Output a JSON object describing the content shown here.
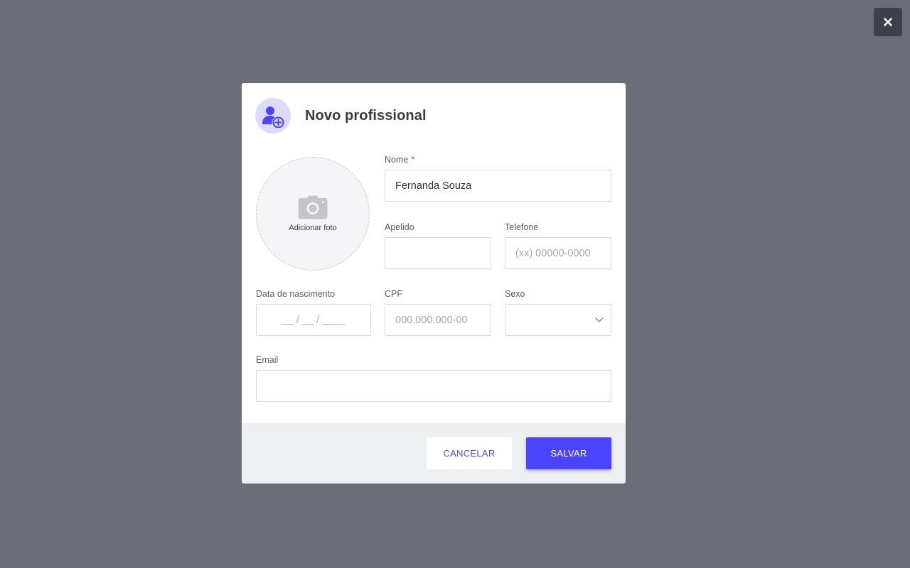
{
  "overlay": {
    "close_icon": "close-icon"
  },
  "modal": {
    "title": "Novo profissional",
    "header_icon": "user-plus-icon",
    "photo": {
      "icon": "camera-icon",
      "label": "Adicionar foto"
    },
    "fields": {
      "nome": {
        "label": "Nome",
        "required_mark": "*",
        "value": "Fernanda Souza",
        "placeholder": ""
      },
      "apelido": {
        "label": "Apelido",
        "value": "",
        "placeholder": ""
      },
      "telefone": {
        "label": "Telefone",
        "value": "",
        "placeholder": "(xx) 00000-0000"
      },
      "data_nascimento": {
        "label": "Data de nascimento",
        "value": "",
        "placeholder": "__ / __ / ____"
      },
      "cpf": {
        "label": "CPF",
        "value": "",
        "placeholder": "000.000.000-00"
      },
      "sexo": {
        "label": "Sexo",
        "value": ""
      },
      "email": {
        "label": "Email",
        "value": "",
        "placeholder": ""
      }
    },
    "footer": {
      "cancel_label": "CANCELAR",
      "save_label": "SALVAR"
    }
  },
  "colors": {
    "backdrop": "#6b6e77",
    "accent": "#4a43ff",
    "icon_bg": "#dcdbff",
    "required": "#e53a3a"
  }
}
